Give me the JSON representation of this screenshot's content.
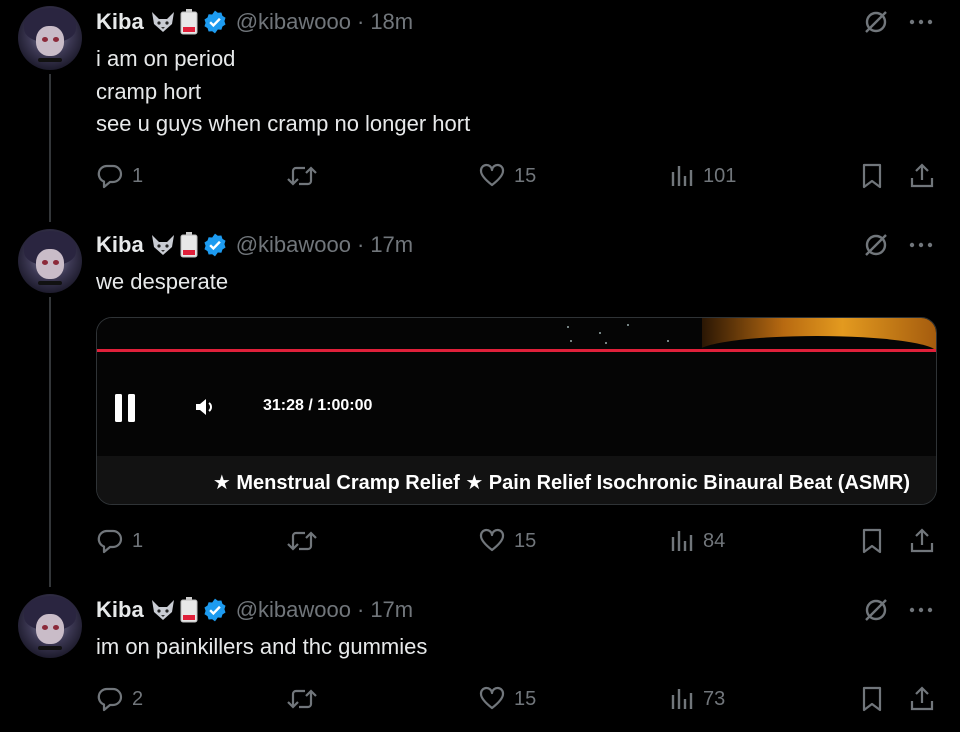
{
  "tweets": [
    {
      "author_name": "Kiba",
      "handle": "@kibawooo",
      "separator": "·",
      "time": "18m",
      "lines": [
        "i am on period",
        "cramp hort",
        "see u guys when cramp no longer hort"
      ],
      "replies": "1",
      "retweets": "",
      "likes": "15",
      "views": "101"
    },
    {
      "author_name": "Kiba",
      "handle": "@kibawooo",
      "separator": "·",
      "time": "17m",
      "lines": [
        "we desperate"
      ],
      "replies": "1",
      "retweets": "",
      "likes": "15",
      "views": "84",
      "media": {
        "timecode": "31:28 / 1:00:00",
        "title": "★ Menstrual Cramp Relief ★ Pain Relief Isochronic Binaural Beat (ASMR)",
        "progress": 0.524,
        "progress_color": "#e0203a"
      }
    },
    {
      "author_name": "Kiba",
      "handle": "@kibawooo",
      "separator": "·",
      "time": "17m",
      "lines": [
        "im on painkillers and thc gummies"
      ],
      "replies": "2",
      "retweets": "",
      "likes": "15",
      "views": "73"
    }
  ],
  "colors": {
    "background": "#000000",
    "text": "#e7e9ea",
    "muted": "#71767b",
    "verified": "#1d9bf0",
    "thread_line": "#333639"
  },
  "icons": {
    "reply": "reply-icon",
    "retweet": "retweet-icon",
    "like": "heart-icon",
    "views": "views-icon",
    "bookmark": "bookmark-icon",
    "share": "share-icon",
    "grok": "grok-icon",
    "more": "more-icon"
  }
}
